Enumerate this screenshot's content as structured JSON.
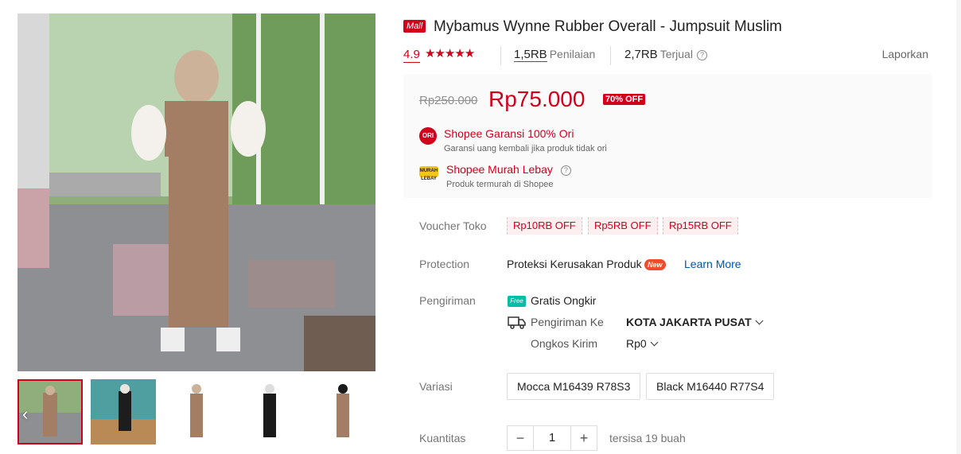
{
  "product": {
    "mall_badge": "Mall",
    "title": "Mybamus Wynne Rubber Overall - Jumpsuit Muslim",
    "rating": "4.9",
    "stars": "★★★★★",
    "reviews_count": "1,5RB",
    "reviews_label": "Penilaian",
    "sold_count": "2,7RB",
    "sold_label": "Terjual",
    "report_label": "Laporkan"
  },
  "price": {
    "original": "Rp250.000",
    "current": "Rp75.000",
    "discount": "70% OFF"
  },
  "perks": [
    {
      "icon": "ori-icon",
      "title": "Shopee Garansi 100% Ori",
      "subtitle": "Garansi uang kembali jika produk tidak ori"
    },
    {
      "icon": "murah-lebay-icon",
      "title": "Shopee Murah Lebay",
      "subtitle": "Produk termurah di Shopee"
    }
  ],
  "perk_icon_text": {
    "ori": "ORI",
    "murah": "MURAH LEBAY"
  },
  "vouchers": {
    "label": "Voucher Toko",
    "items": [
      "Rp10RB OFF",
      "Rp5RB OFF",
      "Rp15RB OFF"
    ]
  },
  "protection": {
    "label": "Protection",
    "text": "Proteksi Kerusakan Produk",
    "badge": "New",
    "link": "Learn More"
  },
  "shipping": {
    "label": "Pengiriman",
    "free_badge": "Free",
    "free_text": "Gratis Ongkir",
    "to_label": "Pengiriman Ke",
    "to_value": "KOTA JAKARTA PUSAT",
    "cost_label": "Ongkos Kirim",
    "cost_value": "Rp0"
  },
  "variations": {
    "label": "Variasi",
    "options": [
      "Mocca M16439 R78S3",
      "Black M16440 R77S4"
    ]
  },
  "quantity": {
    "label": "Kuantitas",
    "value": "1",
    "minus": "−",
    "plus": "+",
    "stock": "tersisa 19 buah"
  },
  "gallery": {
    "thumb_nav": "‹"
  },
  "colors": {
    "accent": "#d0011b",
    "link": "#0055aa",
    "free_green": "#00bfa5"
  }
}
